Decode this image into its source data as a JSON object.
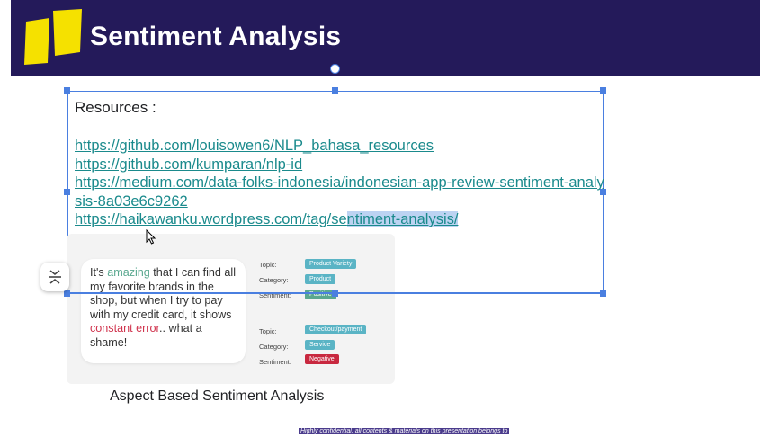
{
  "slide": {
    "title": "Sentiment Analysis",
    "resources_label": "Resources :",
    "links": [
      "https://github.com/louisowen6/NLP_bahasa_resources",
      "https://github.com/kumparan/nlp-id",
      "https://medium.com/data-folks-indonesia/indonesian-app-review-sentiment-analysis-8a03e6c9262"
    ],
    "last_link_prefix": "https://haikawanku.wordpress.com/tag/se",
    "last_link_highlighted": "ntiment-analysis/",
    "image": {
      "quote_parts": [
        "It's ",
        "amazing",
        " that I can find all my favorite brands in the shop, but when I try to pay with my credit card, it shows ",
        "constant error",
        ".. what a shame!"
      ],
      "aspects": [
        {
          "label": "Topic:",
          "tag": "Product Variety",
          "color": "#5ab4c5"
        },
        {
          "label": "Category:",
          "tag": "Product",
          "color": "#5ab4c5"
        },
        {
          "label": "Sentiment:",
          "tag": "Positive",
          "color": "#5aa88f"
        },
        {
          "label": "Topic:",
          "tag": "Checkout/payment",
          "color": "#5ab4c5"
        },
        {
          "label": "Category:",
          "tag": "Service",
          "color": "#5ab4c5"
        },
        {
          "label": "Sentiment:",
          "tag": "Negative",
          "color": "#c8283f"
        }
      ]
    },
    "caption": "Aspect Based Sentiment Analysis",
    "footer": "Highly confidential, all contents & materials on this presentation belongs to"
  },
  "colors": {
    "header": "#241a5a",
    "link": "#1a8a8c",
    "selection": "#4a7fe0",
    "logo": "#f5e100"
  },
  "icons": {
    "align": "vertical-align-icon",
    "cursor": "arrow-cursor-icon"
  }
}
